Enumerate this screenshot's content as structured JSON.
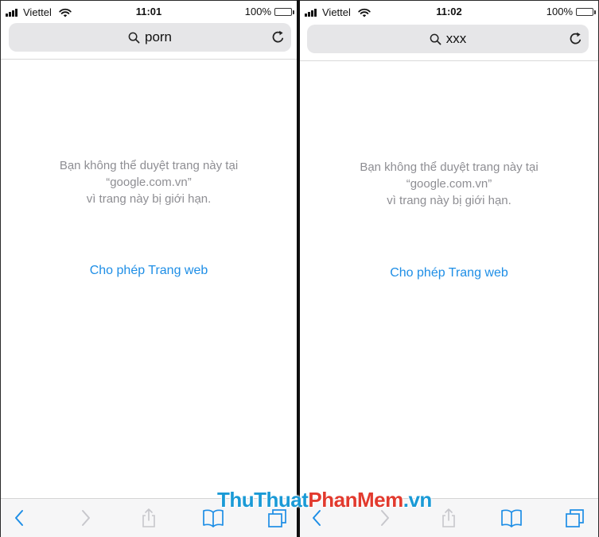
{
  "colors": {
    "accent": "#1e8ee6",
    "message": "#8e8e93",
    "battery": "#f5c518",
    "watermark_blue": "#1a9ad6",
    "watermark_red": "#e23a2e"
  },
  "left": {
    "status": {
      "carrier": "Viettel",
      "time": "11:01",
      "battery": "100%"
    },
    "url": {
      "query": "porn"
    },
    "message": {
      "line1": "Bạn không thể duyệt trang này tại",
      "line2": "“google.com.vn”",
      "line3": "vì trang này bị giới hạn."
    },
    "allow_link": "Cho phép Trang web"
  },
  "right": {
    "status": {
      "carrier": "Viettel",
      "time": "11:02",
      "battery": "100%"
    },
    "url": {
      "query": "xxx"
    },
    "message": {
      "line1": "Bạn không thể duyệt trang này tại",
      "line2": "“google.com.vn”",
      "line3": "vì trang này bị giới hạn."
    },
    "allow_link": "Cho phép Trang web"
  },
  "toolbar_icons": [
    "back-icon",
    "forward-icon",
    "share-icon",
    "bookmarks-icon",
    "tabs-icon"
  ],
  "watermark": {
    "part1": "ThuThuat",
    "part2": "PhanMem",
    "part3": ".vn"
  }
}
